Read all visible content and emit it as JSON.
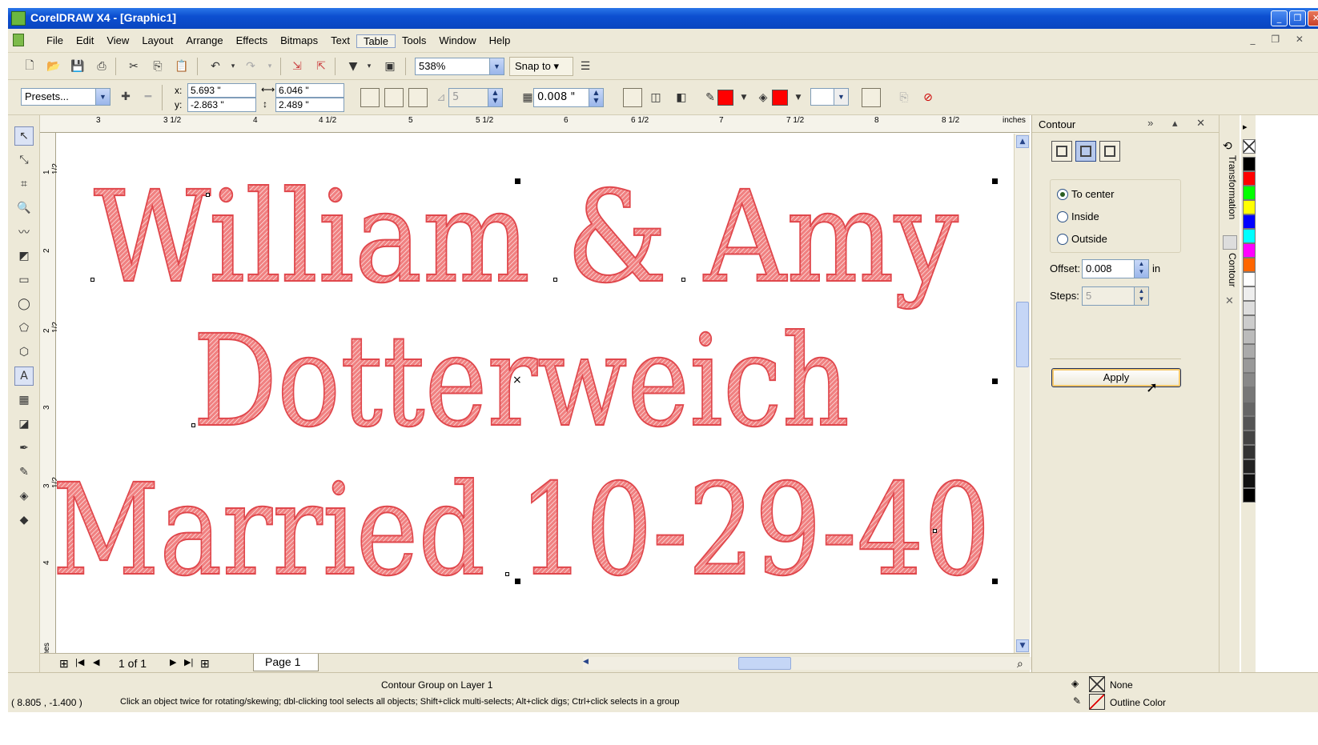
{
  "window": {
    "title": "CorelDRAW X4 - [Graphic1]"
  },
  "menu": [
    "File",
    "Edit",
    "View",
    "Layout",
    "Arrange",
    "Effects",
    "Bitmaps",
    "Text",
    "Table",
    "Tools",
    "Window",
    "Help"
  ],
  "toolbar": {
    "zoom": "538%",
    "snap": "Snap to"
  },
  "propbar": {
    "presets": "Presets...",
    "x_label": "x:",
    "x": "5.693 \"",
    "y_label": "y:",
    "y": "-2.863 \"",
    "w": "6.046 \"",
    "h": "2.489 \"",
    "steps": "5",
    "offset": "0.008 \""
  },
  "ruler": {
    "h": [
      "3",
      "3 1/2",
      "4",
      "4 1/2",
      "5",
      "5 1/2",
      "6",
      "6 1/2",
      "7",
      "7 1/2",
      "8",
      "8 1/2",
      "inches"
    ],
    "v": [
      "1 1/2",
      "2",
      "2 1/2",
      "3",
      "3 1/2",
      "4"
    ],
    "v_unit": "inches"
  },
  "design": {
    "line1": "William & Amy",
    "line2": "Dotterweich",
    "line3": "Married 10-29-40",
    "fill_color": "#f08080",
    "stroke_color": "#e0474c"
  },
  "pager": {
    "count": "1 of 1",
    "tab": "Page 1"
  },
  "status": {
    "object": "Contour Group on Layer 1",
    "coords": "( 8.805 , -1.400 )",
    "hint": "Click an object twice for rotating/skewing; dbl-clicking tool selects all objects; Shift+click multi-selects; Alt+click digs; Ctrl+click selects in a group",
    "fill": "None",
    "outline": "Outline Color"
  },
  "docker": {
    "title": "Contour",
    "options": [
      "To center",
      "Inside",
      "Outside"
    ],
    "selected": "To center",
    "offset_label": "Offset:",
    "offset": "0.008",
    "offset_unit": "in",
    "steps_label": "Steps:",
    "steps": "5",
    "apply": "Apply"
  },
  "side_tabs": [
    "Transformation",
    "Contour"
  ],
  "palette": [
    "#000000",
    "#ff0000",
    "#00ff00",
    "#ffff00",
    "#0000ff",
    "#00ffff",
    "#ff00ff",
    "#ff6600",
    "#ffffff",
    "#eeeeee",
    "#dddddd",
    "#cccccc",
    "#bbbbbb",
    "#aaaaaa",
    "#999999",
    "#888888",
    "#777777",
    "#666666",
    "#555555",
    "#444444",
    "#333333",
    "#222222",
    "#111111",
    "#000000"
  ]
}
